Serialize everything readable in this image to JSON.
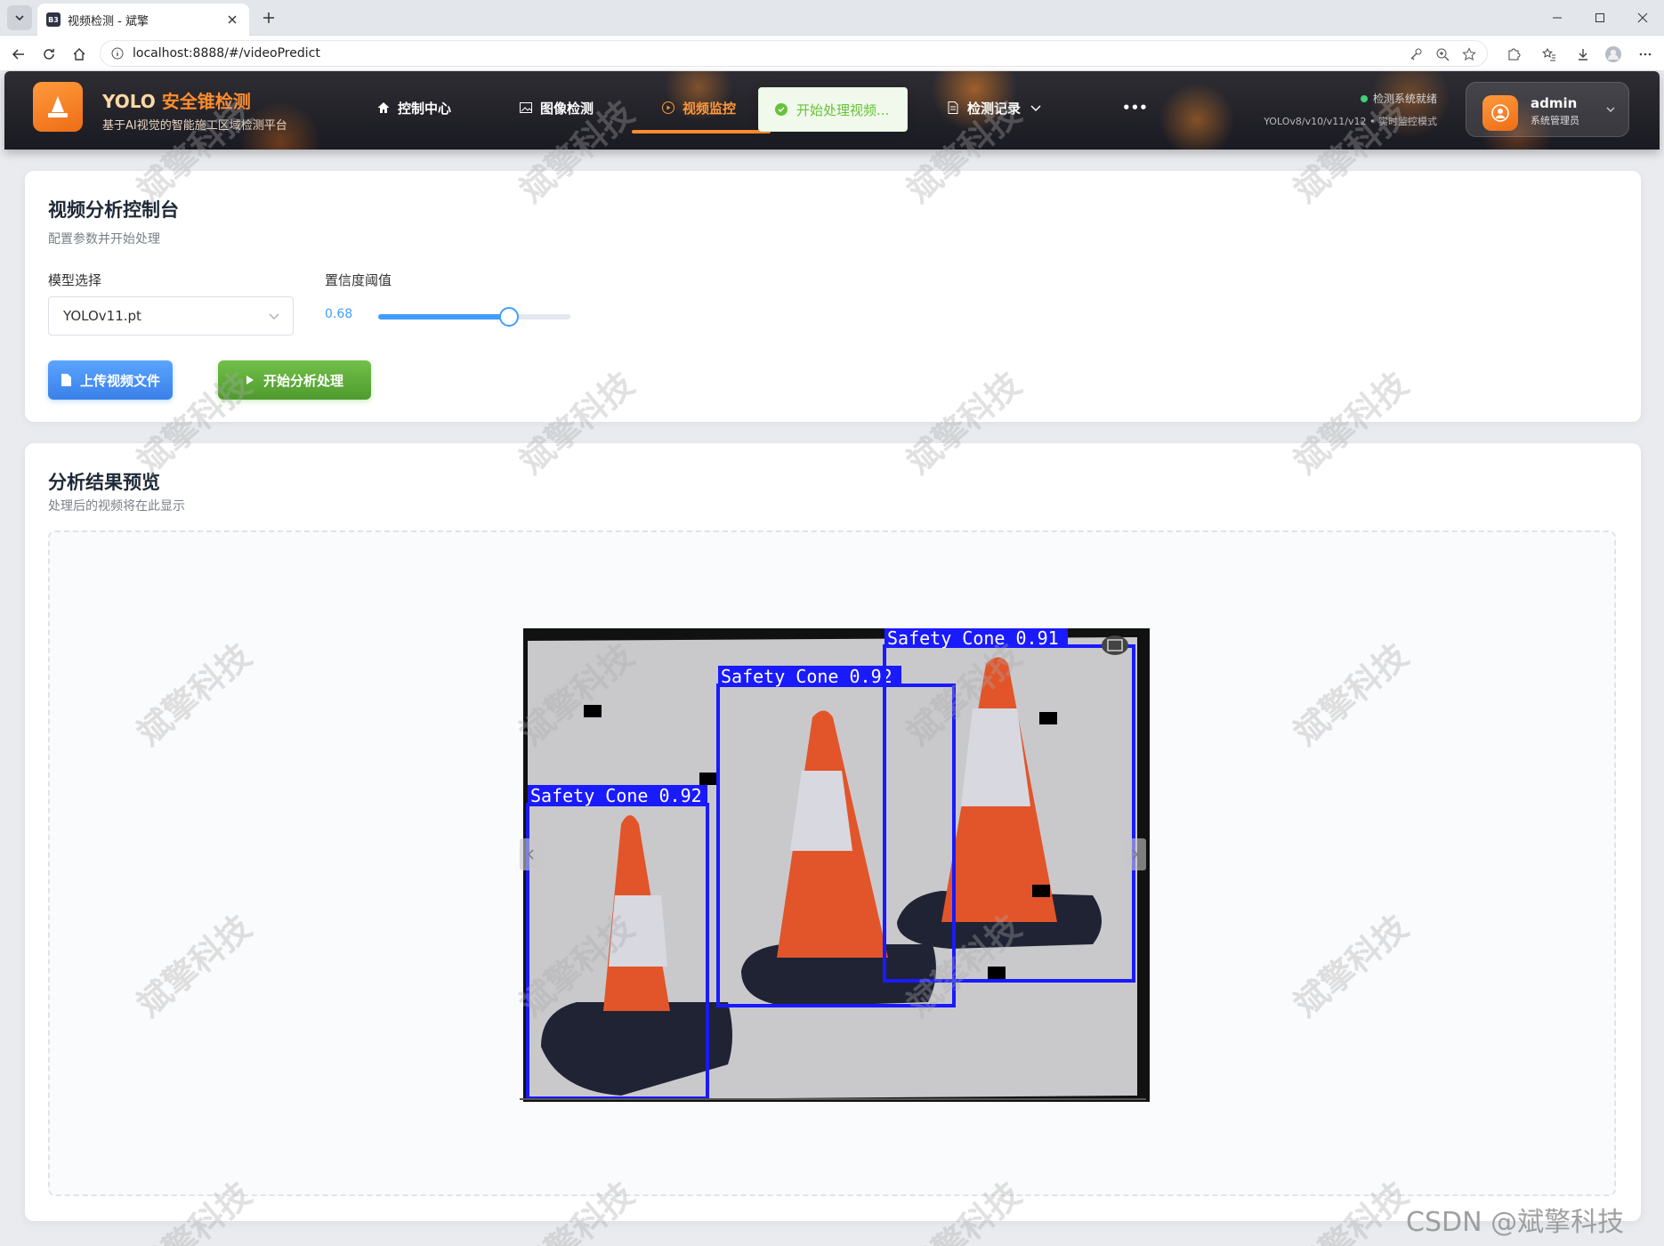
{
  "browser": {
    "tab_title": "视频检测 - 斌擎",
    "favicon_text": "B3",
    "url": "localhost:8888/#/videoPredict"
  },
  "header": {
    "brand_prefix": "YOLO ",
    "brand_highlight": "安全锥检测",
    "subtitle": "基于AI视觉的智能施工区域检测平台",
    "nav": {
      "home": "控制中心",
      "image": "图像检测",
      "video": "视频监控",
      "records": "检测记录",
      "more": "•••"
    },
    "status_text": "检测系统就绪",
    "model_text": "YOLOv8/v10/v11/v12 • 实时监控模式",
    "user": {
      "name": "admin",
      "role": "系统管理员"
    }
  },
  "toast": {
    "message": "开始处理视频..."
  },
  "control": {
    "title": "视频分析控制台",
    "subtitle": "配置参数并开始处理",
    "model_label": "模型选择",
    "model_value": "YOLOv11.pt",
    "conf_label": "置信度阈值",
    "conf_value": "0.68",
    "conf_fraction": 0.68,
    "upload_label": "上传视频文件",
    "start_label": "开始分析处理"
  },
  "result": {
    "title": "分析结果预览",
    "subtitle": "处理后的视频将在此显示"
  },
  "detections": [
    "Safety Cone 0.92",
    "Safety Cone 0.92",
    "Safety Cone 0.91"
  ],
  "watermark": {
    "text": "斌擎科技",
    "csdn": "CSDN @斌擎科技"
  },
  "colors": {
    "accent": "#ff8c2e",
    "primary": "#409eff",
    "success": "#67c23a",
    "box": "#1a1aff"
  }
}
